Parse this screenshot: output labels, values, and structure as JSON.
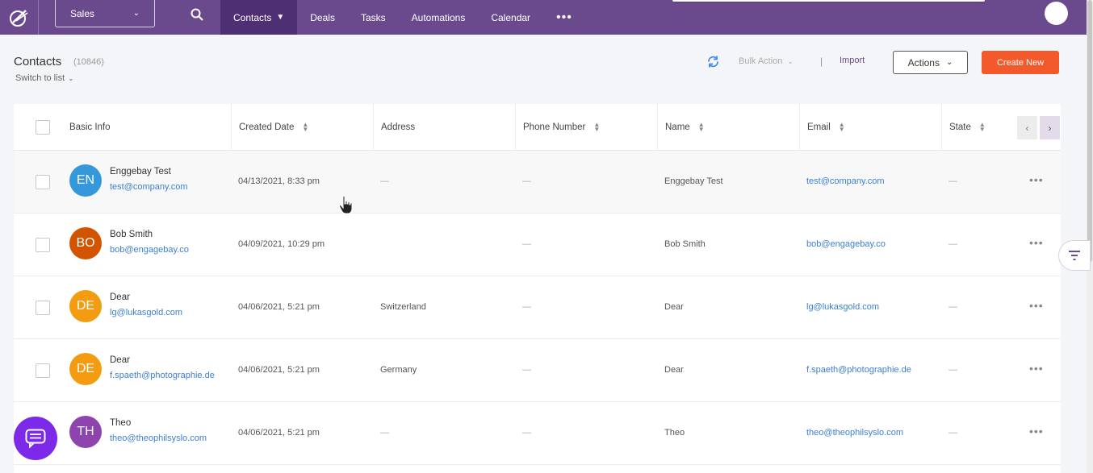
{
  "nav": {
    "module": "Sales",
    "items": [
      {
        "label": "Contacts",
        "active": true,
        "dropdown": true
      },
      {
        "label": "Deals"
      },
      {
        "label": "Tasks"
      },
      {
        "label": "Automations"
      },
      {
        "label": "Calendar"
      }
    ],
    "more": "•••",
    "colors": {
      "bar": "#6a4a8c",
      "active": "#4f2f73"
    }
  },
  "header": {
    "title": "Contacts",
    "count": "(10846)",
    "switch_view": "Switch to list",
    "bulk_action": "Bulk Action",
    "separator": "|",
    "import": "Import",
    "actions": "Actions",
    "create_new": "Create New"
  },
  "table": {
    "columns": [
      {
        "label": "Basic Info",
        "sortable": false
      },
      {
        "label": "Created Date",
        "sortable": true
      },
      {
        "label": "Address",
        "sortable": false
      },
      {
        "label": "Phone Number",
        "sortable": true
      },
      {
        "label": "Name",
        "sortable": true
      },
      {
        "label": "Email",
        "sortable": true
      },
      {
        "label": "State",
        "sortable": true
      }
    ],
    "rows": [
      {
        "initials": "EN",
        "color": "#3498db",
        "name": "Enggebay Test",
        "email": "test@company.com",
        "created": "04/13/2021, 8:33 pm",
        "address": "—",
        "phone": "—",
        "name_col": "Enggebay Test",
        "email_col": "test@company.com",
        "state": "—"
      },
      {
        "initials": "BO",
        "color": "#d35400",
        "name": "Bob Smith",
        "email": "bob@engagebay.co",
        "created": "04/09/2021, 10:29 pm",
        "address": "",
        "phone": "—",
        "name_col": "Bob Smith",
        "email_col": "bob@engagebay.co",
        "state": "—"
      },
      {
        "initials": "DE",
        "color": "#f39c12",
        "name": "Dear",
        "email": "lg@lukasgold.com",
        "created": "04/06/2021, 5:21 pm",
        "address": "Switzerland",
        "phone": "—",
        "name_col": "Dear",
        "email_col": "lg@lukasgold.com",
        "state": "—"
      },
      {
        "initials": "DE",
        "color": "#f39c12",
        "name": "Dear",
        "email": "f.spaeth@photographie.de",
        "created": "04/06/2021, 5:21 pm",
        "address": "Germany",
        "phone": "—",
        "name_col": "Dear",
        "email_col": "f.spaeth@photographie.de",
        "state": "—"
      },
      {
        "initials": "TH",
        "color": "#8e44ad",
        "name": "Theo",
        "email": "theo@theophilsyslo.com",
        "created": "04/06/2021, 5:21 pm",
        "address": "—",
        "phone": "—",
        "name_col": "Theo",
        "email_col": "theo@theophilsyslo.com",
        "state": "—"
      }
    ],
    "row_menu": "•••"
  },
  "icons": {
    "logo": "engagebay-logo-icon",
    "search": "search-icon",
    "refresh": "refresh-icon",
    "filter": "filter-icon",
    "chat": "chat-icon",
    "cursor": "hand-cursor-icon"
  },
  "colors": {
    "accent": "#f4592b",
    "link": "#3d7fd1",
    "import": "#6a4a8c",
    "chat": "#7c2ae8"
  }
}
